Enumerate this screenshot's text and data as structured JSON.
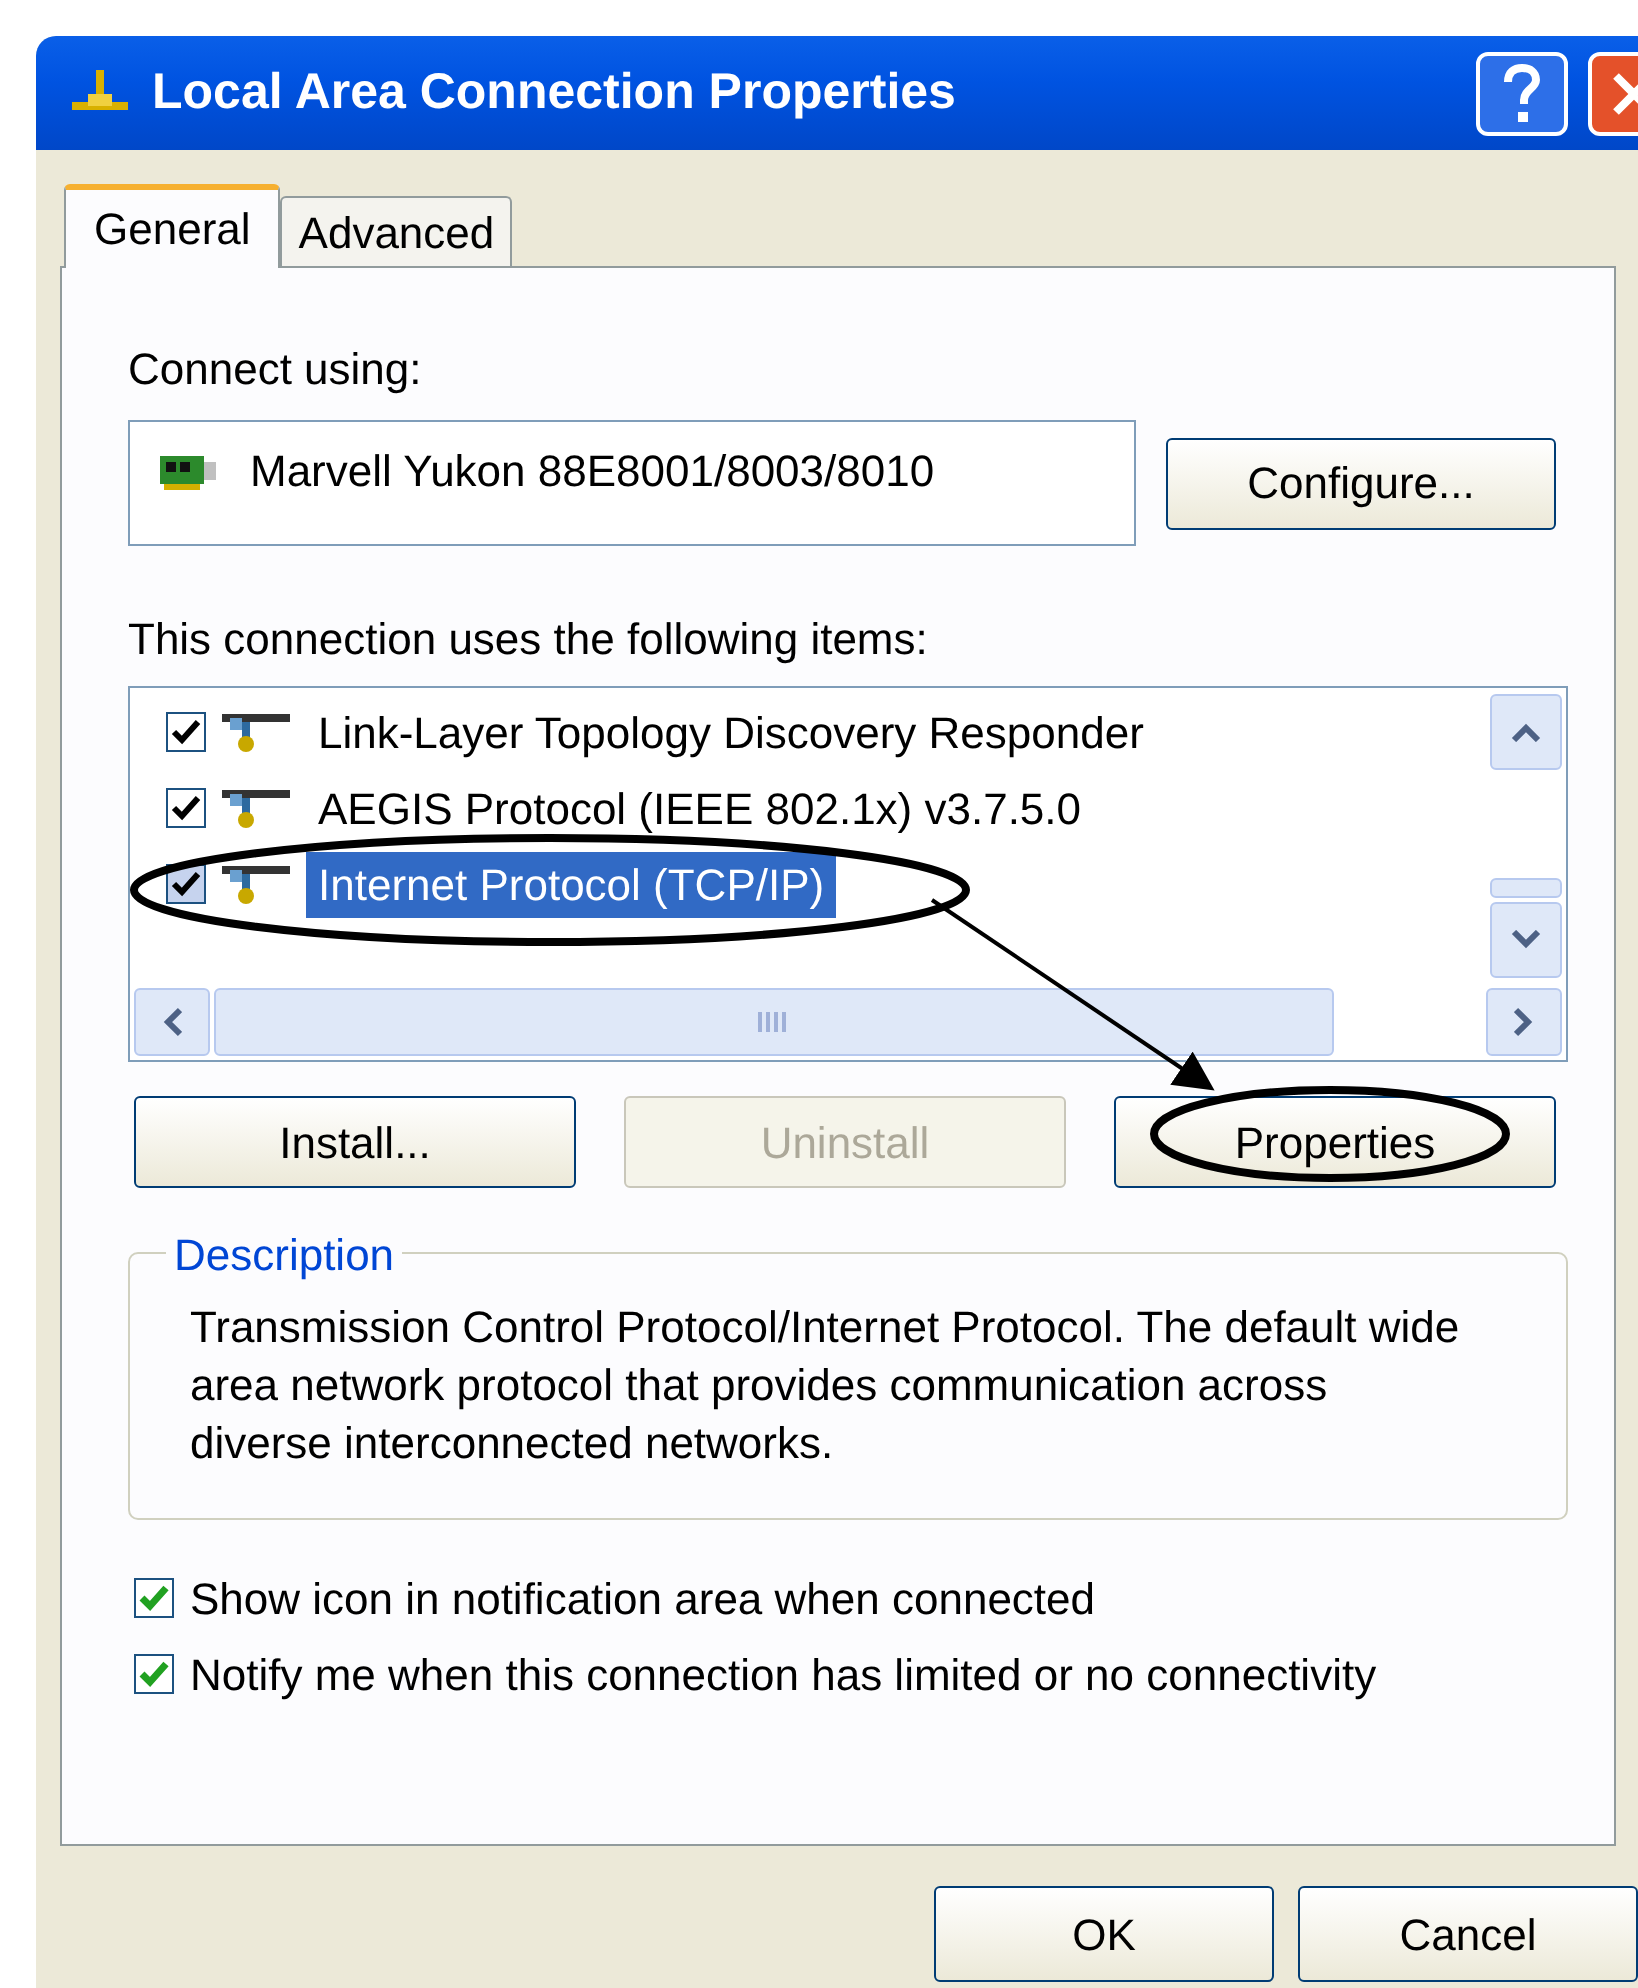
{
  "window": {
    "title": "Local Area Connection Properties"
  },
  "tabs": [
    {
      "label": "General",
      "selected": true
    },
    {
      "label": "Advanced",
      "selected": false
    }
  ],
  "connect_using": {
    "label": "Connect using:",
    "adapter": "Marvell Yukon 88E8001/8003/8010",
    "button": "Configure..."
  },
  "items_label": "This connection uses the following items:",
  "items": [
    {
      "label": "Link-Layer Topology Discovery Responder",
      "checked": true,
      "selected": false
    },
    {
      "label": "AEGIS Protocol (IEEE 802.1x) v3.7.5.0",
      "checked": true,
      "selected": false
    },
    {
      "label": "Internet Protocol (TCP/IP)",
      "checked": true,
      "selected": true
    }
  ],
  "item_buttons": [
    {
      "label": "Install...",
      "disabled": false
    },
    {
      "label": "Uninstall",
      "disabled": true
    },
    {
      "label": "Properties",
      "disabled": false
    }
  ],
  "description": {
    "title": "Description",
    "text": "Transmission Control Protocol/Internet Protocol. The default wide area network protocol that provides communication across diverse interconnected networks."
  },
  "options": [
    {
      "label": "Show icon in notification area when connected",
      "checked": true
    },
    {
      "label": "Notify me when this connection has limited or no connectivity",
      "checked": true
    }
  ],
  "dialog_buttons": [
    "OK",
    "Cancel"
  ]
}
